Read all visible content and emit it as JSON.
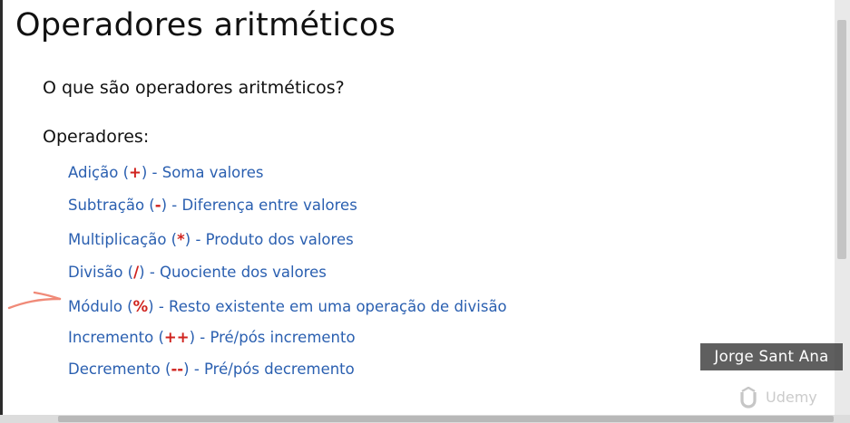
{
  "slide": {
    "title": "Operadores aritméticos",
    "question": "O que são operadores aritméticos?",
    "operators_heading": "Operadores:",
    "operators": [
      {
        "before": "Adição (",
        "symbol": "+",
        "after": ") - Soma valores"
      },
      {
        "before": "Subtração (",
        "symbol": "-",
        "after": ") - Diferença entre valores"
      },
      {
        "before": "Multiplicação (",
        "symbol": "*",
        "after": ") - Produto dos valores"
      },
      {
        "before": "Divisão (",
        "symbol": "/",
        "after": ") - Quociente dos valores"
      },
      {
        "before": "Módulo (",
        "symbol": "%",
        "after": ") - Resto existente em uma operação de divisão"
      },
      {
        "before": "Incremento (",
        "symbol": "++",
        "after": ") - Pré/pós incremento"
      },
      {
        "before": "Decremento (",
        "symbol": "--",
        "after": ") - Pré/pós decremento"
      }
    ]
  },
  "overlay": {
    "author": "Jorge Sant Ana",
    "watermark_text": "Udemy",
    "watermark_icon": "udemy-logo-icon"
  },
  "colors": {
    "operator_text": "#2a5fb0",
    "operator_symbol": "#d0241f",
    "pen_annotation": "#f08a78"
  }
}
